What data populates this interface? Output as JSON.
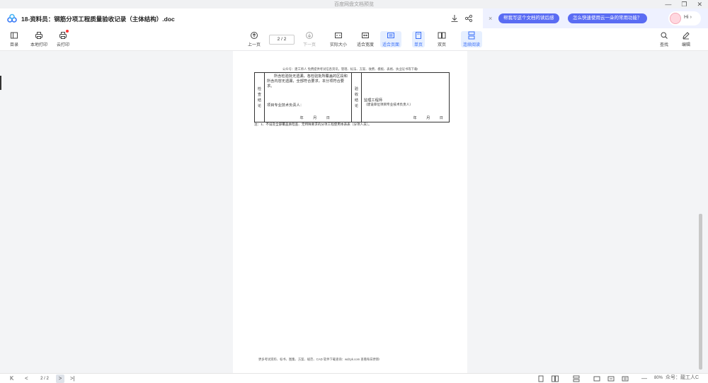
{
  "window": {
    "title": "百度网盘文档预览",
    "minimize": "—",
    "restore": "❐",
    "close": "✕"
  },
  "document": {
    "title": "18-资料员：钢筋分项工程质量验收记录（主体结构）.doc"
  },
  "ai_panel": {
    "close": "×",
    "chip1": "帮我写这个文档的读后感",
    "chip2": "怎么快速使用云一朵的常用功能？",
    "greeting": "Hi"
  },
  "toolbar": {
    "toc": "目录",
    "local_print": "本地打印",
    "cloud_print": "云打印",
    "prev_page": "上一页",
    "page_indicator": "2 / 2",
    "next_page": "下一页",
    "actual_size": "实际大小",
    "fit_width": "适合宽度",
    "fit_page": "适合页面",
    "single_page": "单页",
    "double_page": "双页",
    "continuous": "连续阅读",
    "find": "查找",
    "edit": "编辑"
  },
  "page": {
    "top_note": "公众号：建工师人 免费提供考试信息资讯，管理、标法、方案、收费、模板、表格、执业证书等下载!",
    "left_label": [
      "检",
      "查",
      "结",
      "论"
    ],
    "left_text": "所含检验批无遗漏，各检验批所覆盖的区段和所含内容无遗漏，全部符合要求，本分项符合要求。",
    "left_sign": "项目专业技术负责人：",
    "date_left": "年 月 日",
    "right_label": [
      "验",
      "收",
      "结",
      "论"
    ],
    "right_sign1": "监理工程师",
    "right_sign2": "（建设单位项目专业技术负责人）",
    "date_right": "年 月 日",
    "footnote": "注：1、不设及全部覆盖质检查、无特殊要求的分项工程使用本表表（分项人员）。",
    "bottom_note": "更多考试资料、标书、图集、方案、规范、CAD 软件下载查询：wdzyk.com 查看每日更新!"
  },
  "statusbar": {
    "first": "K",
    "prev": "<",
    "page": "2 / 2",
    "next": ">",
    "last": ">|",
    "zoom_minus": "—",
    "zoom": "80%",
    "watermark": "众号：龍工人C"
  }
}
